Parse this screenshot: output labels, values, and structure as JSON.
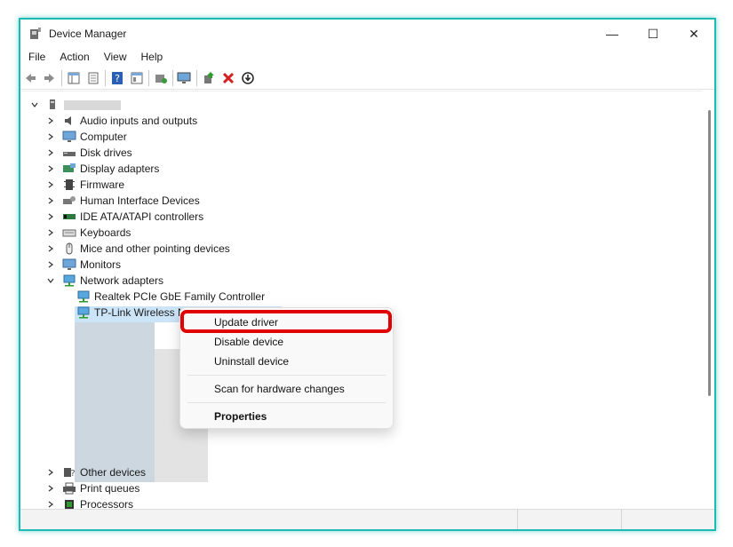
{
  "window": {
    "title": "Device Manager",
    "minimize": "—",
    "maximize": "☐",
    "close": "✕"
  },
  "menu": [
    "File",
    "Action",
    "View",
    "Help"
  ],
  "toolbar": [
    "back-icon",
    "forward-icon",
    "properties-grid-icon",
    "details-icon",
    "help-icon",
    "view-icon",
    "update-icon",
    "scan-icon",
    "add-icon",
    "uninstall-icon",
    "disable-icon"
  ],
  "tree": {
    "root_label": "",
    "categories": [
      {
        "label": "Audio inputs and outputs",
        "icon": "speaker-icon",
        "expanded": false
      },
      {
        "label": "Computer",
        "icon": "monitor-icon",
        "expanded": false
      },
      {
        "label": "Disk drives",
        "icon": "disk-icon",
        "expanded": false
      },
      {
        "label": "Display adapters",
        "icon": "display-adapter-icon",
        "expanded": false
      },
      {
        "label": "Firmware",
        "icon": "firmware-icon",
        "expanded": false
      },
      {
        "label": "Human Interface Devices",
        "icon": "hid-icon",
        "expanded": false
      },
      {
        "label": "IDE ATA/ATAPI controllers",
        "icon": "ide-icon",
        "expanded": false
      },
      {
        "label": "Keyboards",
        "icon": "keyboard-icon",
        "expanded": false
      },
      {
        "label": "Mice and other pointing devices",
        "icon": "mouse-icon",
        "expanded": false
      },
      {
        "label": "Monitors",
        "icon": "monitor-icon",
        "expanded": false
      },
      {
        "label": "Network adapters",
        "icon": "network-icon",
        "expanded": true
      },
      {
        "label": "Realtek PCIe GbE Family Controller",
        "icon": "network-icon",
        "child": true
      },
      {
        "label": "TP-Link Wireless N PCI Express Adapter",
        "icon": "network-icon",
        "child": true,
        "selected": true
      },
      {
        "label": "Other devices",
        "icon": "other-devices-icon",
        "expanded": false
      },
      {
        "label": "Print queues",
        "icon": "printer-icon",
        "expanded": false
      },
      {
        "label": "Processors",
        "icon": "processor-icon",
        "expanded": false
      }
    ]
  },
  "context_menu": {
    "items": [
      "Update driver",
      "Disable device",
      "Uninstall device",
      "Scan for hardware changes",
      "Properties"
    ]
  },
  "colors": {
    "window_border": "#1fb9b4",
    "highlight": "#e00000",
    "selection": "#cce4f7"
  }
}
